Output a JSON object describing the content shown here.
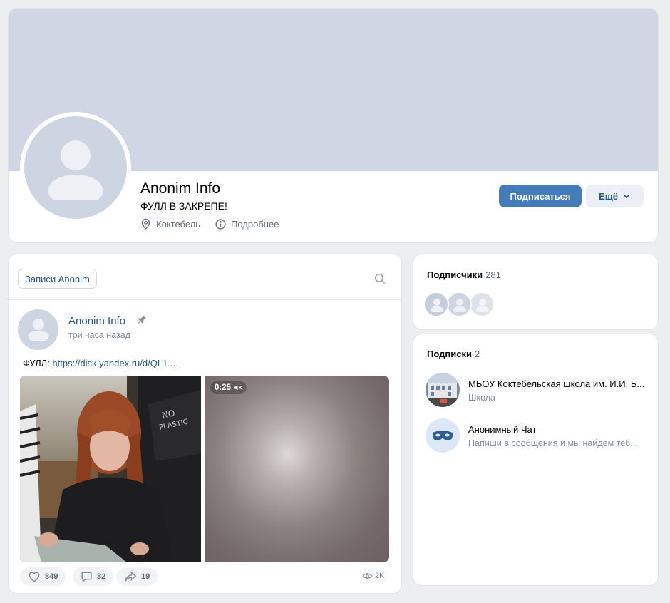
{
  "profile": {
    "name": "Anonim Info",
    "status": "ФУЛЛ В ЗАКРЕПЕ!",
    "location": "Коктебель",
    "details_label": "Подробнее",
    "subscribe_label": "Подписаться",
    "more_label": "Ещё"
  },
  "wall": {
    "tab_label": "Записи Anonim",
    "post": {
      "author": "Anonim Info",
      "time": "три часа назад",
      "text_prefix": "ФУЛЛ: ",
      "link_text": "https://disk.yandex.ru/d/QL1 ...",
      "video_duration": "0:25",
      "likes": "849",
      "comments": "32",
      "shares": "19",
      "views": "2K"
    }
  },
  "followers": {
    "title": "Подписчики",
    "count": "281"
  },
  "following": {
    "title": "Подписки",
    "count": "2",
    "items": [
      {
        "name": "МБОУ Коктебельская школа им. И.И. Б...",
        "subtitle": "Школа"
      },
      {
        "name": "Анонимный Чат",
        "subtitle": "Напиши в сообщения и мы найдем теб..."
      }
    ]
  },
  "colors": {
    "accent": "#447bba",
    "link": "#2a5885",
    "cover": "#d0d6e3",
    "avatar_placeholder": "#ced5e2"
  }
}
